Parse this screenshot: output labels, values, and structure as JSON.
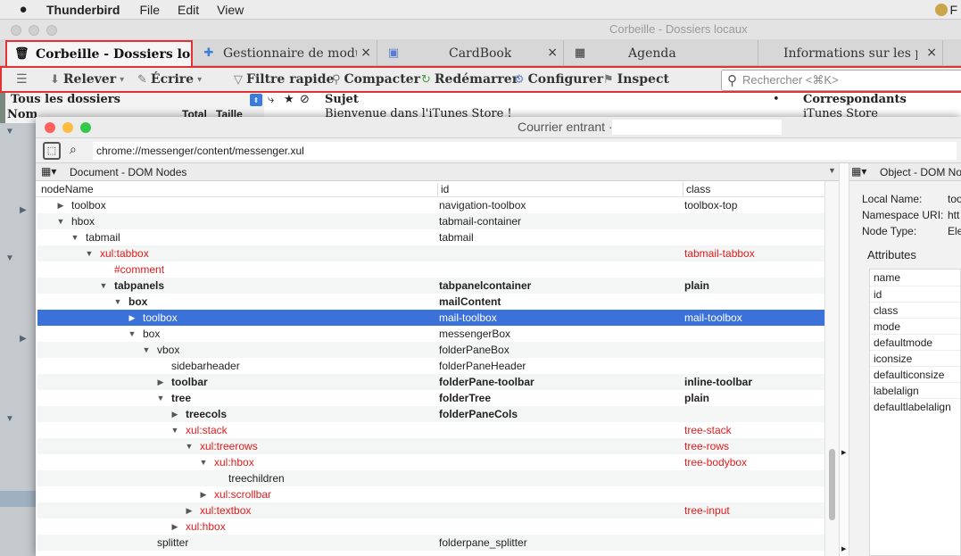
{
  "menubar": {
    "app": "Thunderbird",
    "items": [
      "File",
      "Edit",
      "View"
    ],
    "right_text": "F"
  },
  "window": {
    "title": "Corbeille - Dossiers locaux"
  },
  "tabs": [
    {
      "label": "Corbeille - Dossiers locaux",
      "icon": "trash-icon",
      "active": true
    },
    {
      "label": "Gestionnaire de modules complémentaires",
      "icon": "puzzle-icon"
    },
    {
      "label": "CardBook",
      "icon": "addressbook-icon"
    },
    {
      "label": "Agenda",
      "icon": "calendar-icon"
    },
    {
      "label": "Informations sur les profils",
      "icon": ""
    }
  ],
  "toolbar": {
    "menu": "☰",
    "releve": "Relever",
    "ecrire": "Écrire",
    "filtre": "Filtre rapide",
    "compacter": "Compacter",
    "redemarrer": "Redémarrer",
    "configurer": "Configurer",
    "inspect": "Inspect",
    "search_placeholder": "Rechercher <⌘K>"
  },
  "folder_pane": {
    "header": "Tous les dossiers",
    "col_name": "Nom",
    "col_total": "Total",
    "col_size": "Taille"
  },
  "message_list": {
    "col_subject": "Sujet",
    "col_correspondents": "Correspondants",
    "row_subject": "Bienvenue dans l'iTunes Store !",
    "row_correspondent": "iTunes Store"
  },
  "inspector": {
    "title": "Courrier entrant ·",
    "url": "chrome://messenger/content/messenger.xul",
    "left_panel_title": "Document - DOM Nodes",
    "right_panel_title": "Object - DOM No",
    "columns": {
      "name": "nodeName",
      "id": "id",
      "class": "class"
    },
    "rows": [
      {
        "name": "toolbox",
        "id": "navigation-toolbox",
        "cls": "toolbox-top",
        "depth": 1,
        "tw": "▶"
      },
      {
        "name": "hbox",
        "id": "tabmail-container",
        "cls": "",
        "depth": 1,
        "tw": "▼"
      },
      {
        "name": "tabmail",
        "id": "tabmail",
        "cls": "",
        "depth": 2,
        "tw": "▼"
      },
      {
        "name": "xul:tabbox",
        "id": "",
        "cls": "tabmail-tabbox",
        "depth": 3,
        "tw": "▼",
        "red": true
      },
      {
        "name": "#comment",
        "id": "",
        "cls": "",
        "depth": 4,
        "tw": "",
        "red": true
      },
      {
        "name": "tabpanels",
        "id": "tabpanelcontainer",
        "cls": "plain",
        "depth": 4,
        "tw": "▼",
        "bold": true
      },
      {
        "name": "box",
        "id": "mailContent",
        "cls": "",
        "depth": 5,
        "tw": "▼",
        "bold": true
      },
      {
        "name": "toolbox",
        "id": "mail-toolbox",
        "cls": "mail-toolbox",
        "depth": 6,
        "tw": "▶",
        "sel": true
      },
      {
        "name": "box",
        "id": "messengerBox",
        "cls": "",
        "depth": 6,
        "tw": "▼"
      },
      {
        "name": "vbox",
        "id": "folderPaneBox",
        "cls": "",
        "depth": 7,
        "tw": "▼"
      },
      {
        "name": "sidebarheader",
        "id": "folderPaneHeader",
        "cls": "",
        "depth": 8,
        "tw": ""
      },
      {
        "name": "toolbar",
        "id": "folderPane-toolbar",
        "cls": "inline-toolbar",
        "depth": 8,
        "tw": "▶",
        "bold": true
      },
      {
        "name": "tree",
        "id": "folderTree",
        "cls": "plain",
        "depth": 8,
        "tw": "▼",
        "bold": true
      },
      {
        "name": "treecols",
        "id": "folderPaneCols",
        "cls": "",
        "depth": 9,
        "tw": "▶",
        "bold": true
      },
      {
        "name": "xul:stack",
        "id": "",
        "cls": "tree-stack",
        "depth": 9,
        "tw": "▼",
        "red": true
      },
      {
        "name": "xul:treerows",
        "id": "",
        "cls": "tree-rows",
        "depth": 10,
        "tw": "▼",
        "red": true
      },
      {
        "name": "xul:hbox",
        "id": "",
        "cls": "tree-bodybox",
        "depth": 11,
        "tw": "▼",
        "red": true
      },
      {
        "name": "treechildren",
        "id": "",
        "cls": "",
        "depth": 12,
        "tw": ""
      },
      {
        "name": "xul:scrollbar",
        "id": "",
        "cls": "",
        "depth": 11,
        "tw": "▶",
        "red": true
      },
      {
        "name": "xul:textbox",
        "id": "",
        "cls": "tree-input",
        "depth": 10,
        "tw": "▶",
        "red": true
      },
      {
        "name": "xul:hbox",
        "id": "",
        "cls": "",
        "depth": 9,
        "tw": "▶",
        "red": true
      },
      {
        "name": "splitter",
        "id": "folderpane_splitter",
        "cls": "",
        "depth": 7,
        "tw": ""
      }
    ],
    "object": {
      "local_name_label": "Local Name:",
      "local_name_value": "too",
      "namespace_label": "Namespace URI:",
      "namespace_value": "htt",
      "nodetype_label": "Node Type:",
      "nodetype_value": "Ele",
      "attributes_title": "Attributes",
      "attr_col": "name",
      "attributes": [
        "id",
        "class",
        "mode",
        "defaultmode",
        "iconsize",
        "defaulticonsize",
        "labelalign",
        "defaultlabelalign"
      ]
    }
  }
}
